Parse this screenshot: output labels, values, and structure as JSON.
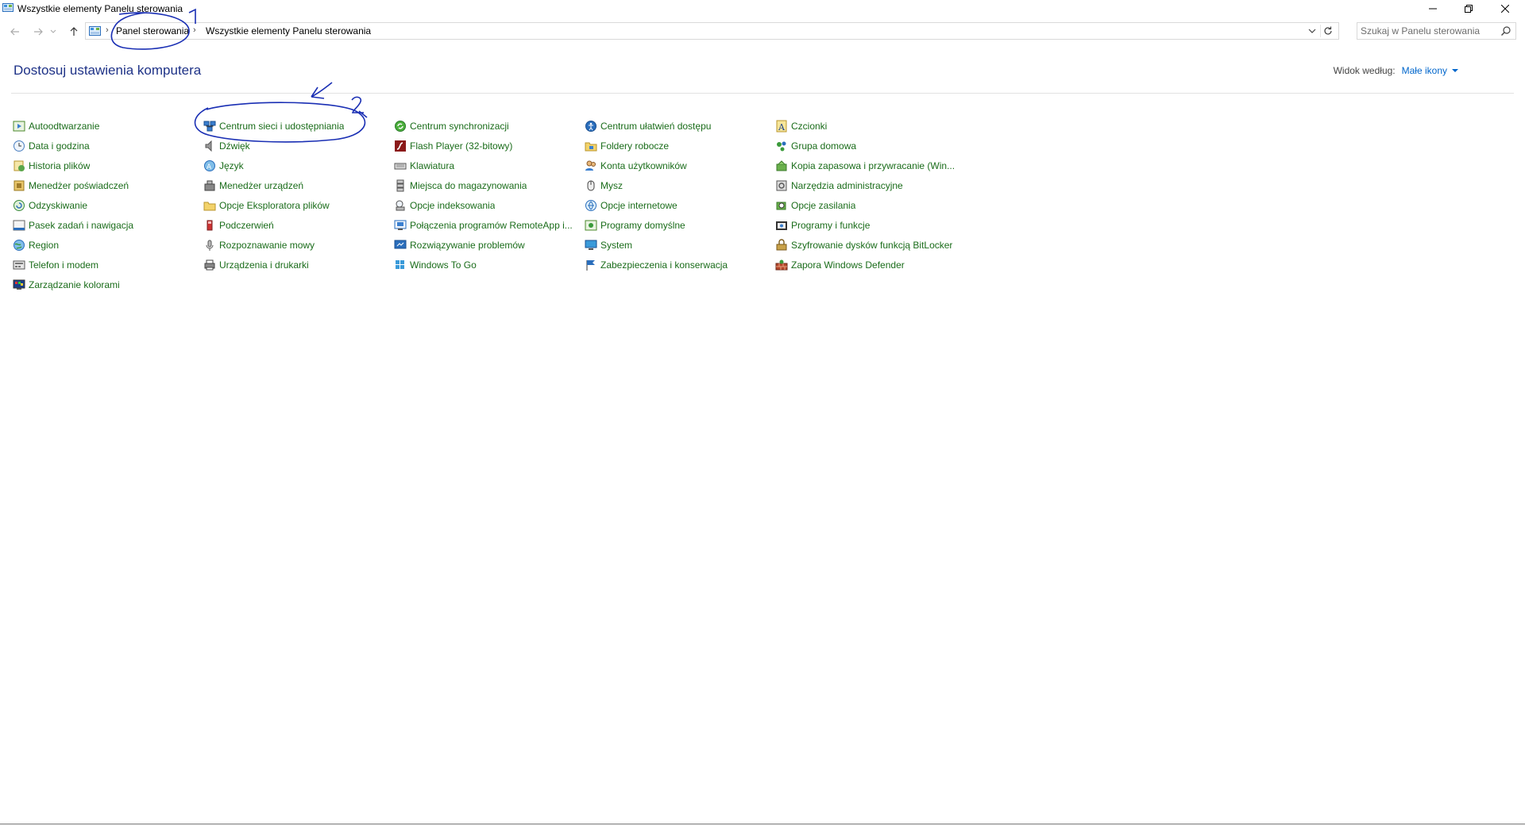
{
  "window": {
    "title": "Wszystkie elementy Panelu sterowania"
  },
  "address": {
    "crumbs": [
      "Panel sterowania",
      "Wszystkie elementy Panelu sterowania"
    ],
    "search_placeholder": "Szukaj w Panelu sterowania"
  },
  "header": {
    "title": "Dostosuj ustawienia komputera",
    "view_by_label": "Widok według:",
    "view_by_value": "Małe ikony"
  },
  "items": {
    "col1": [
      {
        "label": "Autoodtwarzanie",
        "icon": "autoplay-icon"
      },
      {
        "label": "Data i godzina",
        "icon": "clock-icon"
      },
      {
        "label": "Historia plików",
        "icon": "file-history-icon"
      },
      {
        "label": "Menedżer poświadczeń",
        "icon": "credential-icon"
      },
      {
        "label": "Odzyskiwanie",
        "icon": "recovery-icon"
      },
      {
        "label": "Pasek zadań i nawigacja",
        "icon": "taskbar-icon"
      },
      {
        "label": "Region",
        "icon": "globe-icon"
      },
      {
        "label": "Telefon i modem",
        "icon": "phone-icon"
      },
      {
        "label": "Zarządzanie kolorami",
        "icon": "color-management-icon"
      }
    ],
    "col2": [
      {
        "label": "Centrum sieci i udostępniania",
        "icon": "network-icon"
      },
      {
        "label": "Dźwięk",
        "icon": "speaker-icon"
      },
      {
        "label": "Język",
        "icon": "language-icon"
      },
      {
        "label": "Menedżer urządzeń",
        "icon": "device-manager-icon"
      },
      {
        "label": "Opcje Eksploratora plików",
        "icon": "folder-options-icon"
      },
      {
        "label": "Podczerwień",
        "icon": "infrared-icon"
      },
      {
        "label": "Rozpoznawanie mowy",
        "icon": "microphone-icon"
      },
      {
        "label": "Urządzenia i drukarki",
        "icon": "printer-icon"
      }
    ],
    "col3": [
      {
        "label": "Centrum synchronizacji",
        "icon": "sync-icon"
      },
      {
        "label": "Flash Player (32-bitowy)",
        "icon": "flash-icon"
      },
      {
        "label": "Klawiatura",
        "icon": "keyboard-icon"
      },
      {
        "label": "Miejsca do magazynowania",
        "icon": "storage-icon"
      },
      {
        "label": "Opcje indeksowania",
        "icon": "indexing-icon"
      },
      {
        "label": "Połączenia programów RemoteApp i...",
        "icon": "remoteapp-icon"
      },
      {
        "label": "Rozwiązywanie problemów",
        "icon": "troubleshoot-icon"
      },
      {
        "label": "Windows To Go",
        "icon": "windows-to-go-icon"
      }
    ],
    "col4": [
      {
        "label": "Centrum ułatwień dostępu",
        "icon": "accessibility-icon"
      },
      {
        "label": "Foldery robocze",
        "icon": "work-folders-icon"
      },
      {
        "label": "Konta użytkowników",
        "icon": "users-icon"
      },
      {
        "label": "Mysz",
        "icon": "mouse-icon"
      },
      {
        "label": "Opcje internetowe",
        "icon": "internet-options-icon"
      },
      {
        "label": "Programy domyślne",
        "icon": "default-programs-icon"
      },
      {
        "label": "System",
        "icon": "system-icon"
      },
      {
        "label": "Zabezpieczenia i konserwacja",
        "icon": "flag-icon"
      }
    ],
    "col5": [
      {
        "label": "Czcionki",
        "icon": "fonts-icon"
      },
      {
        "label": "Grupa domowa",
        "icon": "homegroup-icon"
      },
      {
        "label": "Kopia zapasowa i przywracanie (Win...",
        "icon": "backup-icon"
      },
      {
        "label": "Narzędzia administracyjne",
        "icon": "admin-tools-icon"
      },
      {
        "label": "Opcje zasilania",
        "icon": "power-icon"
      },
      {
        "label": "Programy i funkcje",
        "icon": "programs-icon"
      },
      {
        "label": "Szyfrowanie dysków funkcją BitLocker",
        "icon": "bitlocker-icon"
      },
      {
        "label": "Zapora Windows Defender",
        "icon": "firewall-icon"
      }
    ]
  },
  "annotations": {
    "mark1": "1",
    "mark2": "2",
    "color": "#1a2fb4"
  }
}
